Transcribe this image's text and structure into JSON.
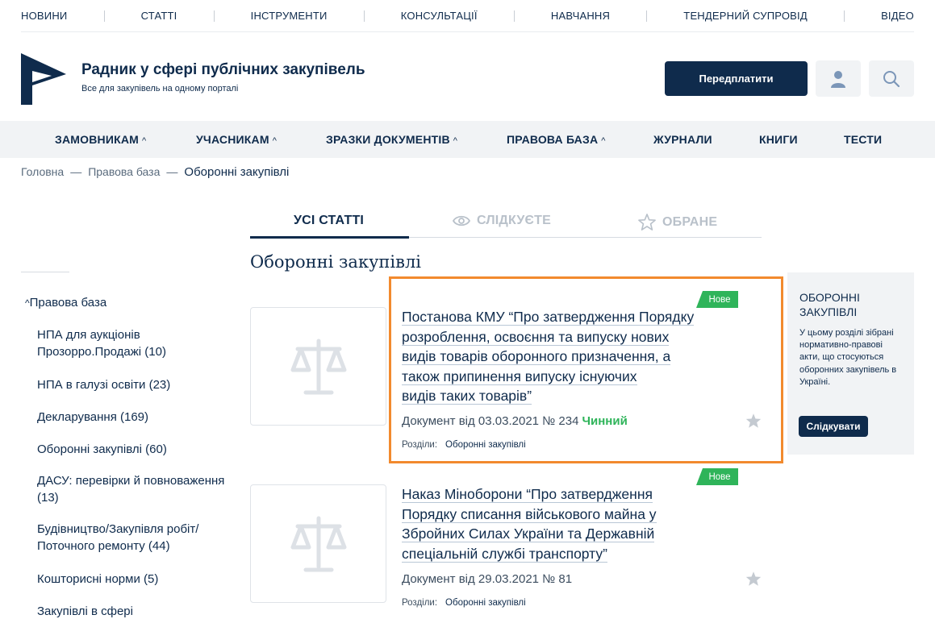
{
  "topnav": [
    "НОВИНИ",
    "СТАТТІ",
    "ІНСТРУМЕНТИ",
    "КОНСУЛЬТАЦІЇ",
    "НАВЧАННЯ",
    "ТЕНДЕРНИЙ СУПРОВІД",
    "ВІДЕО"
  ],
  "brand": {
    "title": "Радник у сфері публічних закупівель",
    "subtitle": "Все для закупівель на одному порталі"
  },
  "header": {
    "subscribe_label": "Передплатити",
    "user_icon": "user-icon",
    "search_icon": "search-icon"
  },
  "mainmenu": {
    "items": [
      {
        "label": "ЗАМОВНИКАМ",
        "chevron": "^"
      },
      {
        "label": "УЧАСНИКАМ",
        "chevron": "^"
      },
      {
        "label": "ЗРАЗКИ ДОКУМЕНТІВ",
        "chevron": "^"
      },
      {
        "label": "ПРАВОВА БАЗА",
        "chevron": "^"
      },
      {
        "label": "ЖУРНАЛИ"
      },
      {
        "label": "КНИГИ"
      },
      {
        "label": "ТЕСТИ"
      }
    ]
  },
  "breadcrumb": {
    "home": "Головна",
    "parent": "Правова база",
    "current": "Оборонні закупівлі",
    "separator": "—"
  },
  "tabs": [
    {
      "label": "УСІ СТАТТІ",
      "active": true
    },
    {
      "label": "СЛІДКУЄТЕ",
      "icon": "eye-icon"
    },
    {
      "label": "ОБРАНЕ",
      "icon": "star-icon"
    }
  ],
  "section_title": "Оборонні закупівлі",
  "sidebar": {
    "parent": "Правова база",
    "parent_chevron": "^",
    "items": [
      {
        "label": "НПА для аукціонів Прозорро.Продажі (10)"
      },
      {
        "label": "НПА в галузі освіти (23)"
      },
      {
        "label": "Декларування (169)"
      },
      {
        "label": "Оборонні закупівлі (60)"
      },
      {
        "label": "ДАСУ: перевірки й повноваження (13)"
      },
      {
        "label": "Будівництво/Закупівля робіт/ Поточного ремонту (44)"
      },
      {
        "label": "Кошторисні норми (5)"
      },
      {
        "label": "Закупівлі в сфері"
      }
    ]
  },
  "cards": [
    {
      "badge": "Нове",
      "title_lines": [
        "Постанова КМУ “Про затвердження Порядку",
        "розроблення, освоєння та випуску нових",
        "видів товарів оборонного призначення, а",
        "також припинення випуску існуючих",
        "видів таких товарів”"
      ],
      "meta": "Документ від 03.03.2021 № 234",
      "status": "Чинний",
      "sections_label": "Розділи:",
      "section_link": "Оборонні закупівлі"
    },
    {
      "badge": "Нове",
      "title_lines": [
        "Наказ Міноборони “Про затвердження",
        "Порядку списання військового майна у",
        "Збройних Силах України та Державній",
        "спеціальній службі транспорту”"
      ],
      "meta": "Документ від 29.03.2021 № 81",
      "status": "",
      "sections_label": "Розділи:",
      "section_link": "Оборонні закупівлі"
    }
  ],
  "infobox": {
    "title": "ОБОРОННІ ЗАКУПІВЛІ",
    "text": "У цьому розділі зібрані нормативно-правові акти, що стосуються оборонних закупівель в Україні.",
    "follow_label": "Слідкувати"
  },
  "colors": {
    "primary": "#0f2b4c",
    "accent_green": "#2fb45a",
    "highlight_orange": "#f28a2e",
    "panel_gray": "#f1f3f5"
  }
}
